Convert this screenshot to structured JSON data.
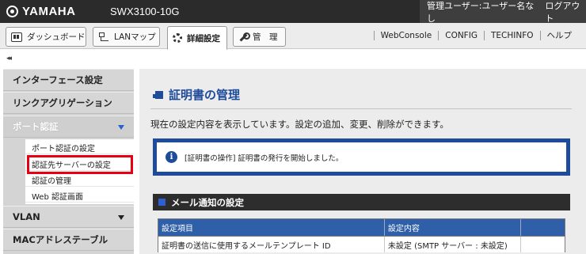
{
  "header": {
    "logo_text": "YAMAHA",
    "model": "SWX3100-10G",
    "user_label": "管理ユーザー:",
    "user_name": "ユーザー名なし",
    "logout": "ログアウト"
  },
  "tabs": [
    {
      "label": "ダッシュボード",
      "icon": "dashboard-icon"
    },
    {
      "label": "LANマップ",
      "icon": "lan-map-icon"
    },
    {
      "label": "詳細設定",
      "icon": "gear-icon"
    },
    {
      "label": "管　理",
      "icon": "wrench-icon"
    }
  ],
  "header_links": [
    "WebConsole",
    "CONFIG",
    "TECHINFO",
    "ヘルプ"
  ],
  "collapse_glyph": "◂◂",
  "sidebar": {
    "items": [
      {
        "label": "インターフェース設定"
      },
      {
        "label": "リンクアグリゲーション"
      },
      {
        "label": "ポート認証"
      },
      {
        "label": "VLAN"
      },
      {
        "label": "MACアドレステーブル"
      }
    ],
    "sub_items": [
      {
        "label": "ポート認証の設定"
      },
      {
        "label": "認証先サーバーの設定"
      },
      {
        "label": "認証の管理"
      },
      {
        "label": "Web 認証画面"
      }
    ]
  },
  "main": {
    "title": "証明書の管理",
    "description": "現在の設定内容を表示しています。設定の追加、変更、削除ができます。",
    "notice": "[証明書の操作] 証明書の発行を開始しました。",
    "info_glyph": "i",
    "section_title": "メール通知の設定",
    "table": {
      "headers": [
        "設定項目",
        "設定内容"
      ],
      "rows": [
        [
          "証明書の送信に使用するメールテンプレート ID",
          "未設定 (SMTP サーバー : 未設定)"
        ]
      ]
    }
  },
  "colors": {
    "accent": "#1e4b9a",
    "highlight": "#e60012",
    "topbar": "#2b2b2b"
  }
}
